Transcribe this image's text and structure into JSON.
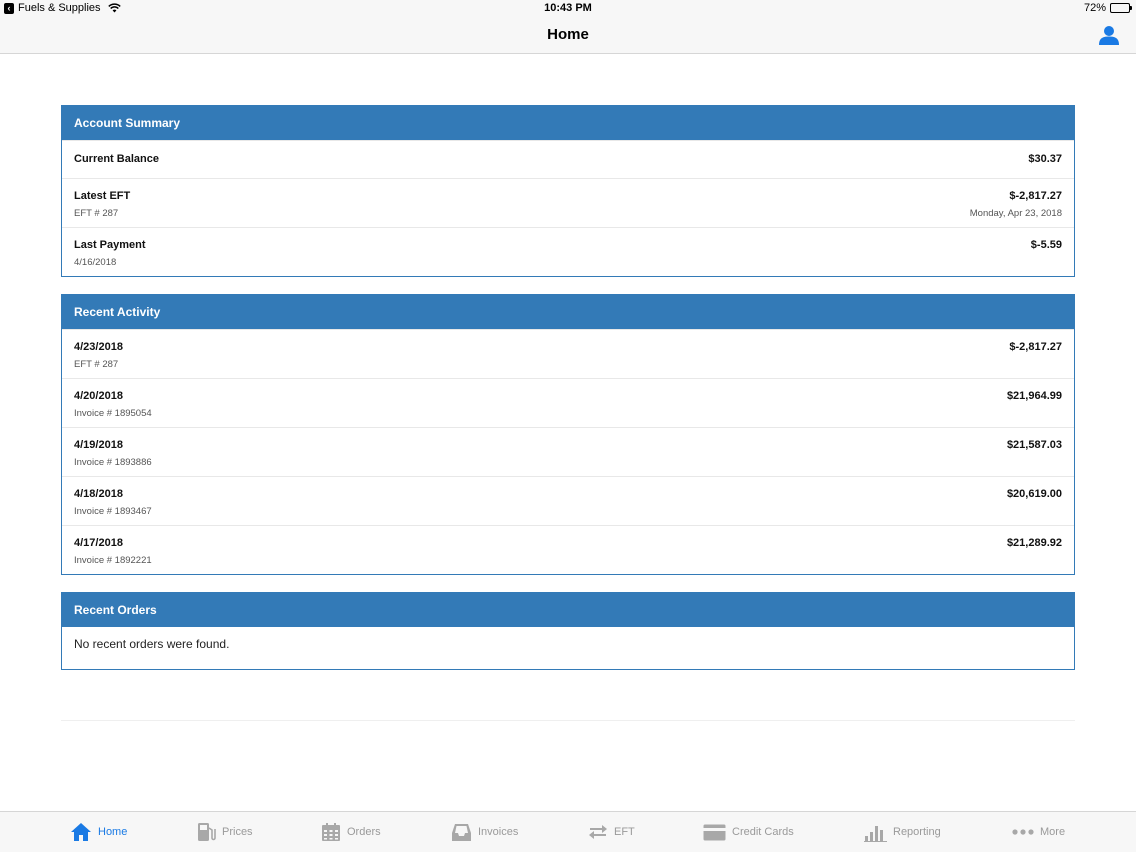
{
  "status_bar": {
    "carrier": "Fuels & Supplies",
    "time": "10:43 PM",
    "battery_percent": "72%",
    "battery_level": 0.72
  },
  "nav": {
    "title": "Home",
    "user_icon": "user-icon"
  },
  "account_summary": {
    "heading": "Account Summary",
    "rows": [
      {
        "label": "Current Balance",
        "value": "$30.37"
      },
      {
        "label": "Latest EFT",
        "sublabel": "EFT # 287",
        "value": "$-2,817.27",
        "subvalue": "Monday, Apr 23, 2018"
      },
      {
        "label": "Last Payment",
        "sublabel": "4/16/2018",
        "value": "$-5.59"
      }
    ]
  },
  "recent_activity": {
    "heading": "Recent Activity",
    "rows": [
      {
        "date": "4/23/2018",
        "ref": "EFT # 287",
        "amount": "$-2,817.27"
      },
      {
        "date": "4/20/2018",
        "ref": "Invoice # 1895054",
        "amount": "$21,964.99"
      },
      {
        "date": "4/19/2018",
        "ref": "Invoice # 1893886",
        "amount": "$21,587.03"
      },
      {
        "date": "4/18/2018",
        "ref": "Invoice # 1893467",
        "amount": "$20,619.00"
      },
      {
        "date": "4/17/2018",
        "ref": "Invoice # 1892221",
        "amount": "$21,289.92"
      }
    ]
  },
  "recent_orders": {
    "heading": "Recent Orders",
    "empty_message": "No recent orders were found."
  },
  "tabs": [
    {
      "label": "Home",
      "icon": "home-icon",
      "active": true
    },
    {
      "label": "Prices",
      "icon": "fuel-pump-icon",
      "active": false
    },
    {
      "label": "Orders",
      "icon": "calendar-icon",
      "active": false
    },
    {
      "label": "Invoices",
      "icon": "inbox-icon",
      "active": false
    },
    {
      "label": "EFT",
      "icon": "transfer-arrows-icon",
      "active": false
    },
    {
      "label": "Credit Cards",
      "icon": "credit-card-icon",
      "active": false
    },
    {
      "label": "Reporting",
      "icon": "bar-chart-icon",
      "active": false
    },
    {
      "label": "More",
      "icon": "more-dots-icon",
      "active": false
    }
  ],
  "colors": {
    "panel_primary": "#337ab7",
    "tab_active": "#1a7ae4",
    "tab_inactive": "#9a9a9a"
  }
}
